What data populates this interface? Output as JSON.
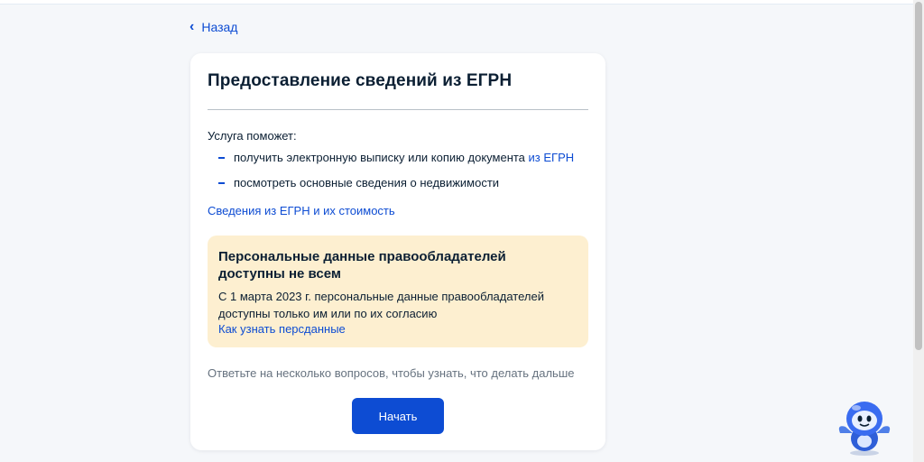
{
  "nav": {
    "back_label": "Назад"
  },
  "card": {
    "title": "Предоставление сведений из ЕГРН",
    "intro": "Услуга поможет:",
    "bullets": [
      {
        "text": "получить электронную выписку или копию документа ",
        "link": "из ЕГРН"
      },
      {
        "text": "посмотреть основные сведения о недвижимости"
      }
    ],
    "cost_link": "Сведения из ЕГРН и их стоимость",
    "notice": {
      "title": "Персональные данные правообладателей доступны не всем",
      "text": "С 1 марта 2023 г. персональные данные правообладателей доступны только им или по их согласию",
      "link": "Как узнать персданные"
    },
    "hint": "Ответьте на несколько вопросов, чтобы узнать, что делать дальше",
    "start_button": "Начать"
  },
  "icons": {
    "back": "chevron-left-icon",
    "assistant": "robot-assistant-icon"
  },
  "colors": {
    "accent": "#0d4cd3",
    "notice_bg": "#fdefd0",
    "page_bg": "#f5f7fa"
  }
}
